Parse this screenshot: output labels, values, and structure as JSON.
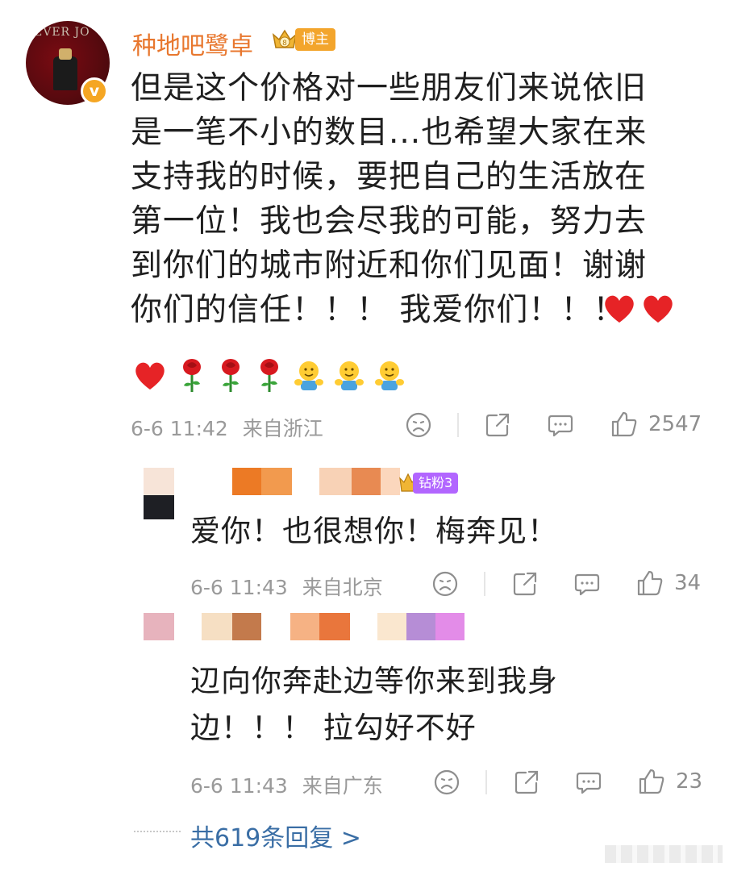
{
  "post": {
    "username": "种地吧鹭卓",
    "badge": "博主",
    "verified": "v",
    "text_lines": [
      "但是这个价格对一些朋友们来说依旧",
      "是一笔不小的数目...也希望大家在来",
      "支持我的时候，要把自己的生活放在",
      "第一位！我也会尽我的可能，努力去",
      "到你们的城市附近和你们见面！谢谢",
      "你们的信任！！！ 我爱你们！！！"
    ],
    "emojis": [
      "heart",
      "heart",
      "heart",
      "rose",
      "rose",
      "rose",
      "hug",
      "hug",
      "hug"
    ],
    "date": "6-6 11:42",
    "location": "来自浙江",
    "likes": "2547"
  },
  "replies": [
    {
      "badge": "钻粉3",
      "text_lines": [
        "爱你！也很想你！梅奔见！"
      ],
      "date": "6-6 11:43",
      "location": "来自北京",
      "likes": "34"
    },
    {
      "text_lines": [
        "辺向你奔赴边等你来到我身",
        "边！！！ 拉勾好不好"
      ],
      "date": "6-6 11:43",
      "location": "来自广东",
      "likes": "23"
    }
  ],
  "more_replies": "共619条回复 >",
  "colors": {
    "username": "#e8772e",
    "badge": "#f3a52c",
    "fan_badge": "#b266ff",
    "link": "#3a6ea5",
    "heart": "#e62326"
  }
}
